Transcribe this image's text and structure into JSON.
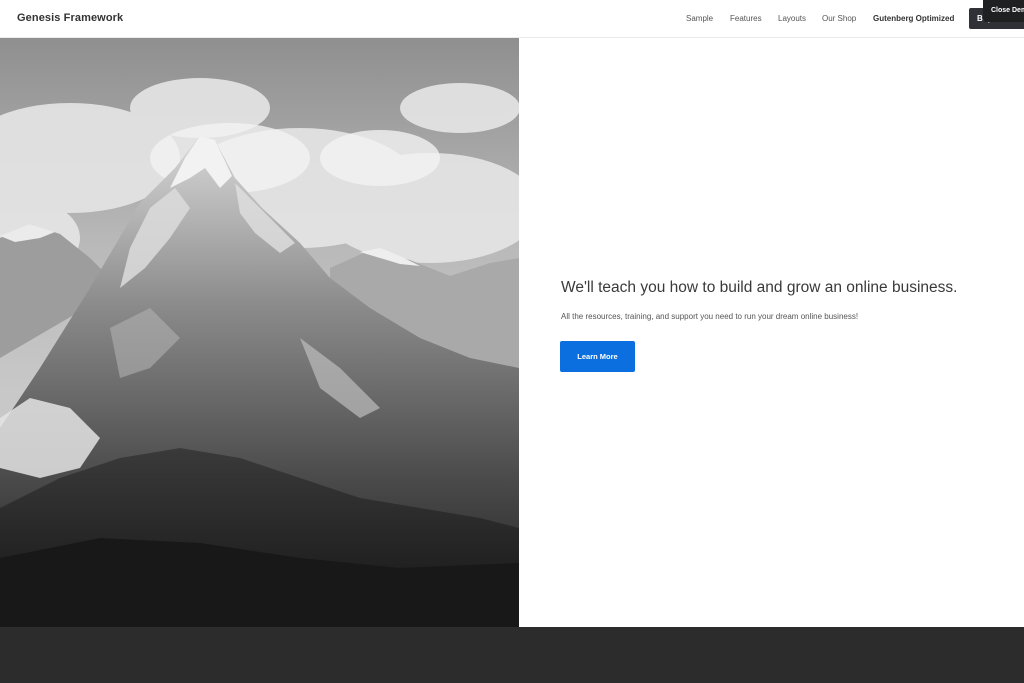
{
  "header": {
    "site_title": "Genesis Framework",
    "nav": [
      {
        "label": "Sample"
      },
      {
        "label": "Features"
      },
      {
        "label": "Layouts"
      },
      {
        "label": "Our Shop"
      },
      {
        "label": "Gutenberg Optimized"
      }
    ],
    "nav_button_label": "Buy",
    "close_tab_label": "Close Demo"
  },
  "hero": {
    "heading": "We'll teach you how to build and grow an online business.",
    "subheading": "All the resources, training, and support you need to run your dream online business!",
    "cta_label": "Learn More"
  },
  "colors": {
    "accent": "#0b6fe0",
    "footer": "#2c2c2c",
    "dark_button": "#2f3136"
  }
}
